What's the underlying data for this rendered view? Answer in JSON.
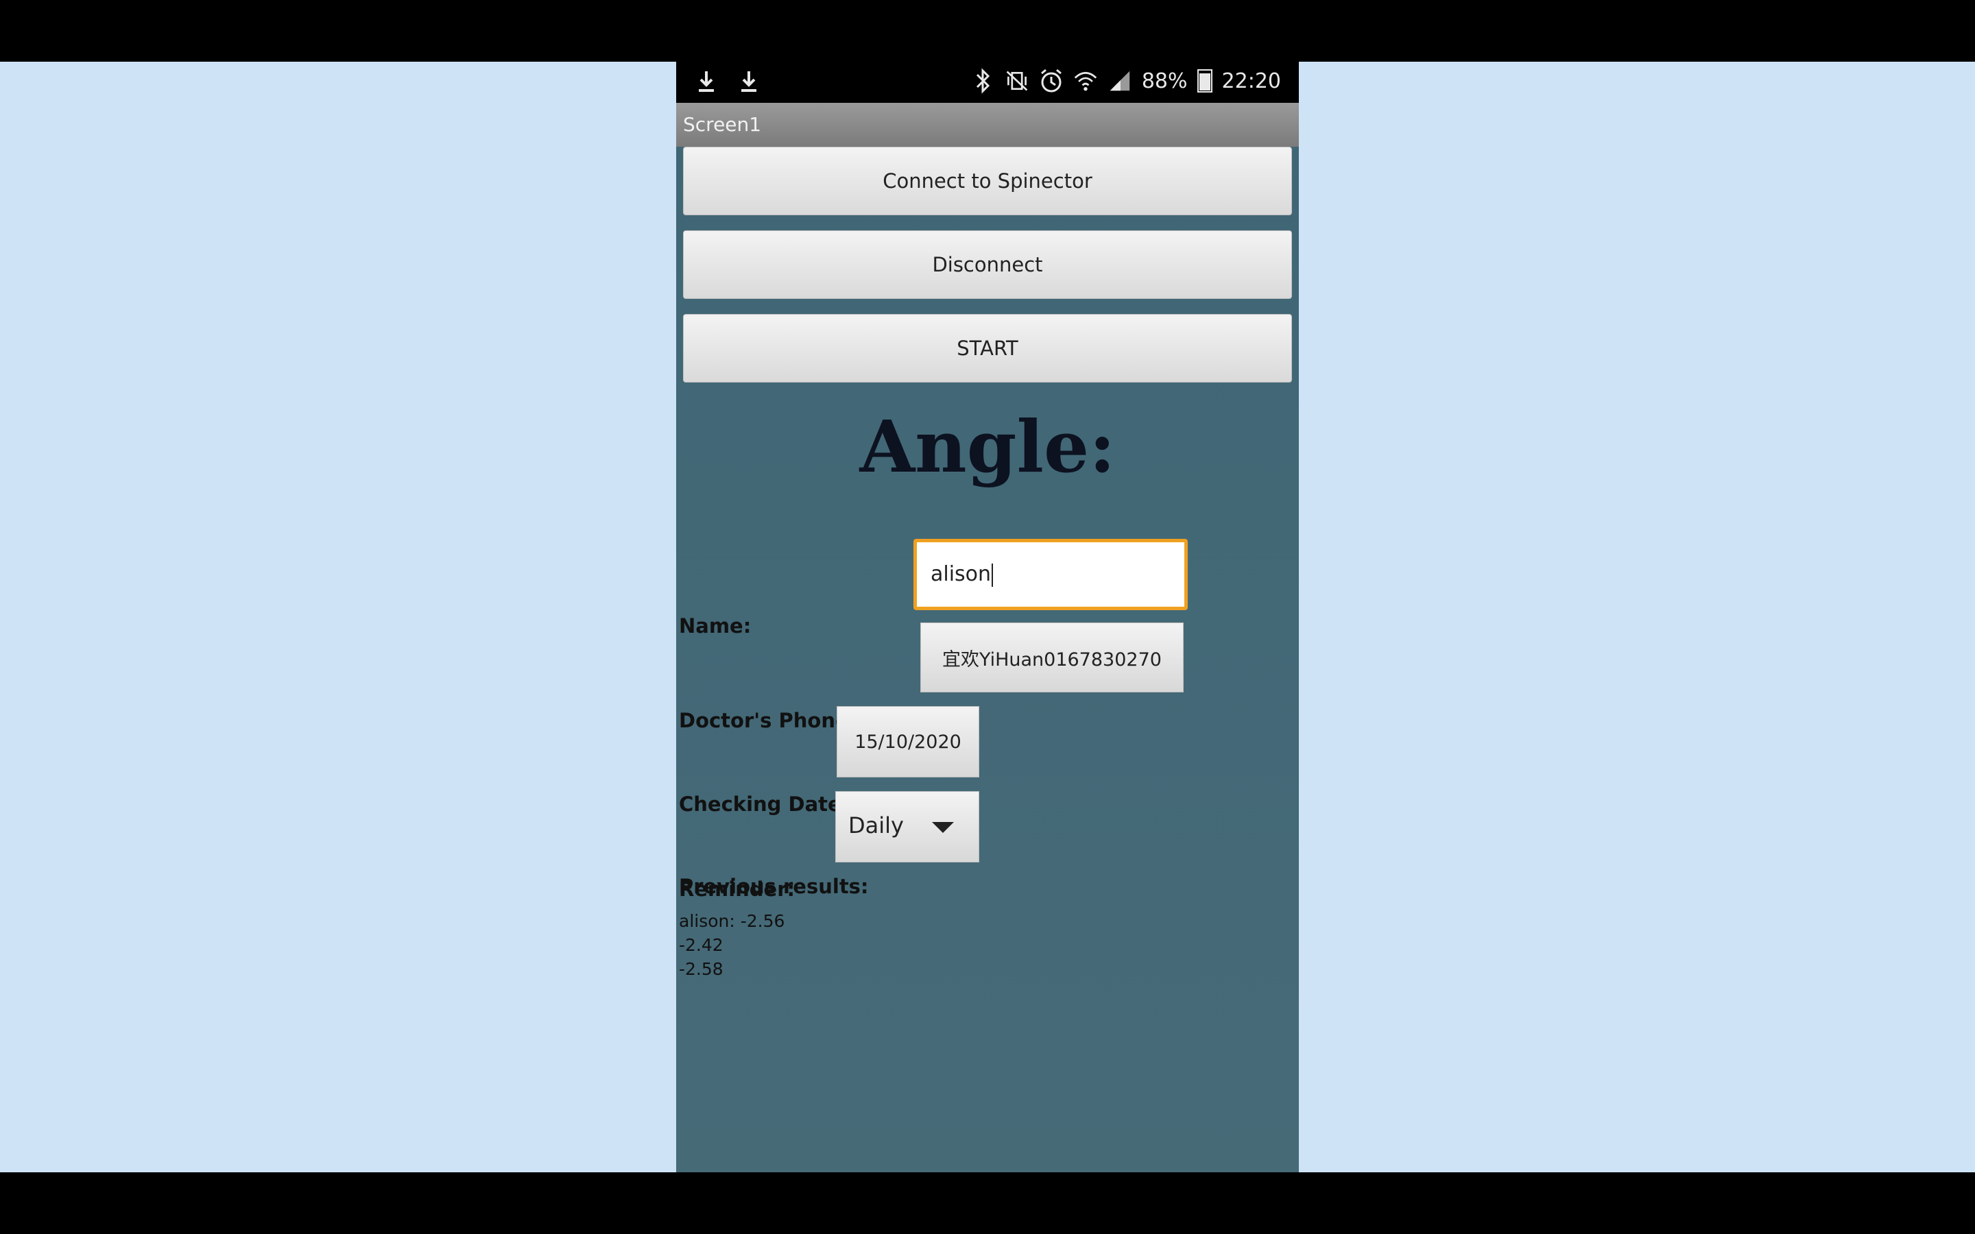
{
  "status_bar": {
    "battery": "88%",
    "time": "22:20",
    "icons": [
      "download-icon",
      "download-icon",
      "bluetooth-icon",
      "vibrate-off-icon",
      "alarm-icon",
      "wifi-icon",
      "signal-icon",
      "battery-icon"
    ],
    "battery_level_percent": 88
  },
  "app": {
    "title": "Screen1"
  },
  "buttons": {
    "connect": "Connect to Spinector",
    "disconnect": "Disconnect",
    "start": "START"
  },
  "angle_label": "Angle:",
  "form": {
    "name_label": "Name:",
    "name_value": "alison",
    "doctor_label": "Doctor's Phone Number:",
    "doctor_value": "宜欢YiHuan0167830270",
    "date_label": "Checking Date:",
    "date_value": "15/10/2020",
    "reminder_label": "Reminder:",
    "reminder_value": "Daily"
  },
  "previous": {
    "title": "Previous results:",
    "lines": [
      "alison: -2.56",
      "-2.42",
      "-2.58"
    ]
  },
  "colors": {
    "app_background": "#43697a",
    "focus_border": "#f0a020",
    "page_background": "#cfe3f7"
  }
}
